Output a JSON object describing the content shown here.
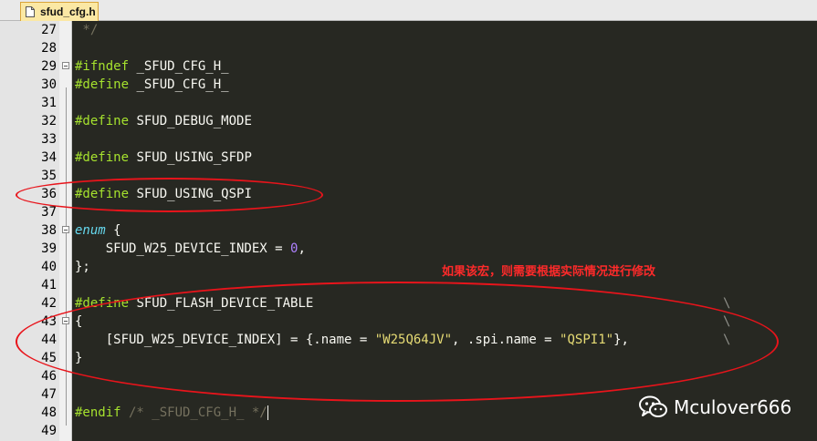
{
  "tab": {
    "label": "sfud_cfg.h",
    "icon": "file-icon"
  },
  "lines": [
    {
      "num": "27",
      "parts": [
        {
          "t": " */",
          "c": "cm"
        }
      ]
    },
    {
      "num": "28",
      "parts": []
    },
    {
      "num": "29",
      "parts": [
        {
          "t": "#ifndef",
          "c": "kw"
        },
        {
          "t": " _SFUD_CFG_H_",
          "c": ""
        }
      ]
    },
    {
      "num": "30",
      "parts": [
        {
          "t": "#define",
          "c": "kw"
        },
        {
          "t": " _SFUD_CFG_H_",
          "c": ""
        }
      ]
    },
    {
      "num": "31",
      "parts": []
    },
    {
      "num": "32",
      "parts": [
        {
          "t": "#define",
          "c": "kw"
        },
        {
          "t": " SFUD_DEBUG_MODE",
          "c": ""
        }
      ]
    },
    {
      "num": "33",
      "parts": []
    },
    {
      "num": "34",
      "parts": [
        {
          "t": "#define",
          "c": "kw"
        },
        {
          "t": " SFUD_USING_SFDP",
          "c": ""
        }
      ]
    },
    {
      "num": "35",
      "parts": []
    },
    {
      "num": "36",
      "parts": [
        {
          "t": "#define",
          "c": "kw"
        },
        {
          "t": " SFUD_USING_QSPI",
          "c": ""
        }
      ]
    },
    {
      "num": "37",
      "parts": []
    },
    {
      "num": "38",
      "parts": [
        {
          "t": "enum",
          "c": "it"
        },
        {
          "t": " {",
          "c": ""
        }
      ]
    },
    {
      "num": "39",
      "parts": [
        {
          "t": "    SFUD_W25_DEVICE_INDEX = ",
          "c": ""
        },
        {
          "t": "0",
          "c": "num"
        },
        {
          "t": ",",
          "c": ""
        }
      ]
    },
    {
      "num": "40",
      "parts": [
        {
          "t": "};",
          "c": ""
        }
      ]
    },
    {
      "num": "41",
      "parts": []
    },
    {
      "num": "42",
      "parts": [
        {
          "t": "#define",
          "c": "kw"
        },
        {
          "t": " SFUD_FLASH_DEVICE_TABLE",
          "c": ""
        }
      ]
    },
    {
      "num": "43",
      "parts": [
        {
          "t": "{",
          "c": ""
        }
      ]
    },
    {
      "num": "44",
      "parts": [
        {
          "t": "    [SFUD_W25_DEVICE_INDEX] = {.name = ",
          "c": ""
        },
        {
          "t": "\"W25Q64JV\"",
          "c": "str"
        },
        {
          "t": ", .spi.name = ",
          "c": ""
        },
        {
          "t": "\"QSPI1\"",
          "c": "str"
        },
        {
          "t": "},",
          "c": ""
        }
      ]
    },
    {
      "num": "45",
      "parts": [
        {
          "t": "}",
          "c": ""
        }
      ]
    },
    {
      "num": "46",
      "parts": []
    },
    {
      "num": "47",
      "parts": []
    },
    {
      "num": "48",
      "parts": [
        {
          "t": "#endif",
          "c": "kw"
        },
        {
          "t": " /* _SFUD_CFG_H_ */",
          "c": "cm"
        }
      ]
    },
    {
      "num": "49",
      "parts": []
    }
  ],
  "continuation": "\\",
  "annotation": "如果该宏，则需要根据实际情况进行修改",
  "watermark": {
    "icon": "wechat-icon",
    "text": "Mculover666"
  },
  "colors": {
    "background": "#272822",
    "keyword": "#a6e22e",
    "enum_keyword": "#66d9ef",
    "number": "#ae81ff",
    "string": "#e6db74",
    "comment": "#75715e",
    "annotation": "#ff2a2a",
    "highlight_ellipse": "#e8141b"
  }
}
